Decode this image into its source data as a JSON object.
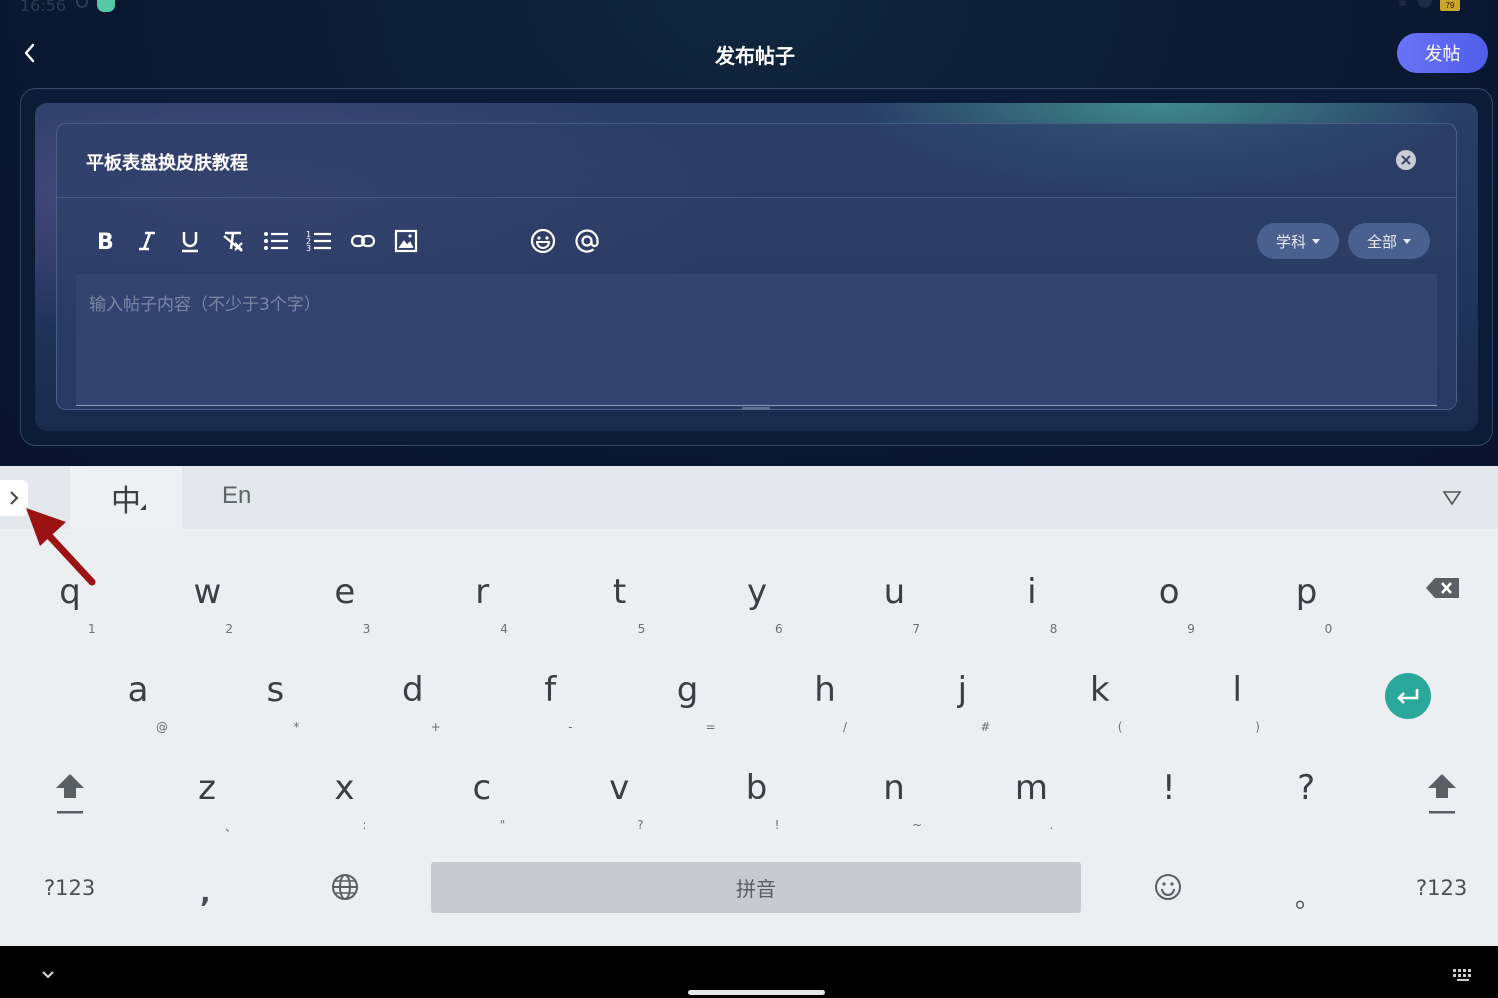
{
  "status_bar": {
    "time": "16:56",
    "battery": "79"
  },
  "header": {
    "title": "发布帖子",
    "publish_label": "发帖"
  },
  "post": {
    "title_value": "平板表盘换皮肤教程",
    "content_placeholder": "输入帖子内容（不少于3个字）"
  },
  "toolbar": {
    "tools": [
      "bold",
      "italic",
      "underline",
      "clear-format",
      "bullet-list",
      "numbered-list",
      "link",
      "image",
      "emoji",
      "mention"
    ],
    "subject_label": "学科",
    "scope_label": "全部"
  },
  "keyboard": {
    "mode_zh": "中",
    "mode_en": "En",
    "row1": [
      {
        "k": "q",
        "s": "1"
      },
      {
        "k": "w",
        "s": "2"
      },
      {
        "k": "e",
        "s": "3"
      },
      {
        "k": "r",
        "s": "4"
      },
      {
        "k": "t",
        "s": "5"
      },
      {
        "k": "y",
        "s": "6"
      },
      {
        "k": "u",
        "s": "7"
      },
      {
        "k": "i",
        "s": "8"
      },
      {
        "k": "o",
        "s": "9"
      },
      {
        "k": "p",
        "s": "0"
      }
    ],
    "row2": [
      {
        "k": "a",
        "s": "@"
      },
      {
        "k": "s",
        "s": "*"
      },
      {
        "k": "d",
        "s": "+"
      },
      {
        "k": "f",
        "s": "-"
      },
      {
        "k": "g",
        "s": "="
      },
      {
        "k": "h",
        "s": "/"
      },
      {
        "k": "j",
        "s": "#"
      },
      {
        "k": "k",
        "s": "("
      },
      {
        "k": "l",
        "s": ")"
      }
    ],
    "row3": [
      {
        "k": "z",
        "s": "、"
      },
      {
        "k": "x",
        "s": ":"
      },
      {
        "k": "c",
        "s": "\""
      },
      {
        "k": "v",
        "s": "?"
      },
      {
        "k": "b",
        "s": "!"
      },
      {
        "k": "n",
        "s": "~"
      },
      {
        "k": "m",
        "s": "."
      },
      {
        "k": "!",
        "s": ""
      },
      {
        "k": "?",
        "s": ""
      }
    ],
    "symbols_label": "?123",
    "comma_label": ",",
    "space_label": "拼音",
    "period_label": "。",
    "symbols_label_right": "?123"
  },
  "colors": {
    "accent": "#5b67f0",
    "enter": "#2aa89b",
    "annotation": "#9b1212"
  }
}
